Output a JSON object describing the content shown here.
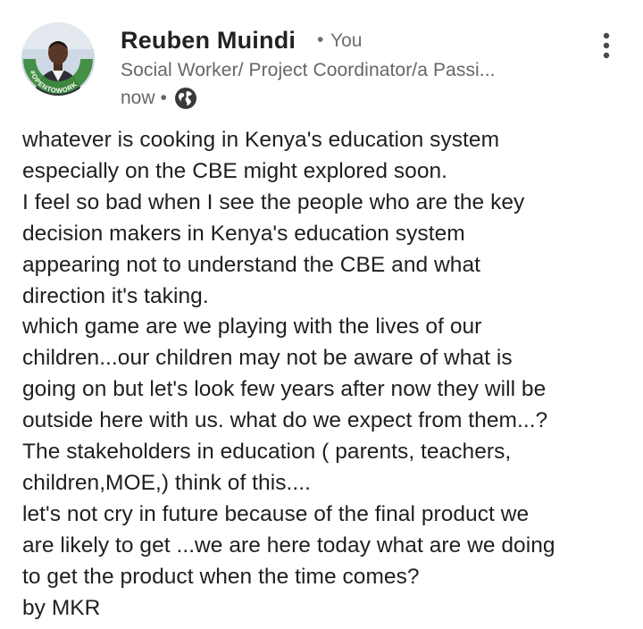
{
  "post": {
    "author": {
      "name": "Reuben Muindi",
      "separator": "•",
      "degree": "You",
      "headline": "Social Worker/ Project Coordinator/a Passi...",
      "avatar_badge": "#OPENTOWORK"
    },
    "meta": {
      "time": "now",
      "separator": "•",
      "visibility_icon": "globe-icon"
    },
    "menu_icon": "more-vertical-icon",
    "body": "whatever is cooking in Kenya's education system\nespecially on the CBE might explored soon.\n I feel so bad when I see the people who are the key\ndecision makers in Kenya's education system\nappearing not to understand the CBE and what\ndirection it's taking.\nwhich game are we playing with the lives of our\nchildren...our children may not be aware of what is\ngoing on but let's look few years after now they will be\noutside here with us. what do we expect from them...?\nThe stakeholders in education ( parents, teachers,\nchildren,MOE,) think of this....\nlet's not cry in future because of the final product we\nare likely to get ...we are here today what are we doing\nto get the product when the time comes?\nby MKR"
  },
  "colors": {
    "open_to_work_ring": "#3d8b3d",
    "avatar_bg": "#d4dde8",
    "text_primary": "#1f1f1f",
    "text_secondary": "#666666"
  }
}
